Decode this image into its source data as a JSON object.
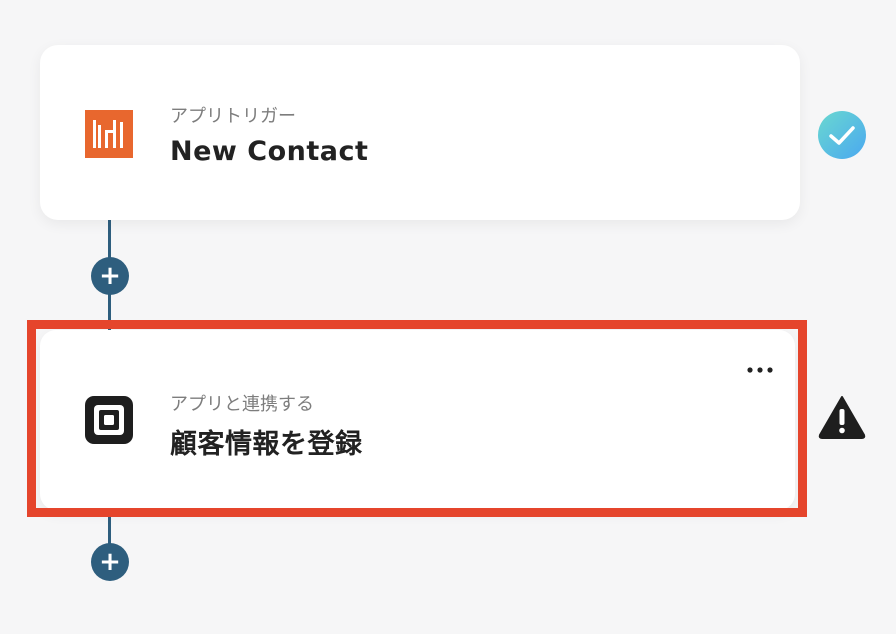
{
  "steps": [
    {
      "subtitle": "アプリトリガー",
      "title": "New Contact",
      "app_icon": "hubspot-style-logo",
      "status": "check-icon",
      "brand_color": "#e8672e"
    },
    {
      "subtitle": "アプリと連携する",
      "title": "顧客情報を登録",
      "app_icon": "square-logo",
      "status": "warning-icon",
      "brand_color": "#1e1e1e"
    }
  ],
  "add_step_label": "+",
  "more_menu_label": "•••",
  "colors": {
    "connector": "#2e5e7e",
    "highlight": "#e5452c",
    "check_gradient_start": "#6ad8d0",
    "check_gradient_end": "#4aa8f0",
    "warning": "#1e1e1e"
  }
}
